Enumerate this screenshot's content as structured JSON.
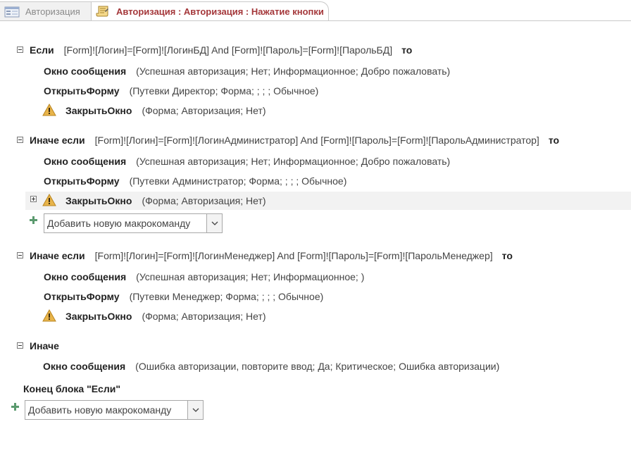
{
  "tabs": [
    {
      "label": "Авторизация",
      "icon": "form-icon",
      "active": false
    },
    {
      "label": "Авторизация : Авторизация : Нажатие кнопки",
      "icon": "macro-icon",
      "active": true
    }
  ],
  "blocks": {
    "if1": {
      "keyword": "Если",
      "condition": "[Form]![Логин]=[Form]![ЛогинБД] And [Form]![Пароль]=[Form]![ПарольБД]",
      "then": "то",
      "actions": [
        {
          "name": "Окно сообщения",
          "args": "(Успешная авторизация; Нет; Информационное; Добро пожаловать)"
        },
        {
          "name": "ОткрытьФорму",
          "args": "(Путевки Директор; Форма; ; ; ; Обычное)"
        },
        {
          "name": "ЗакрытьОкно",
          "args": "(Форма; Авторизация; Нет)",
          "warning": true
        }
      ]
    },
    "elseif1": {
      "keyword": "Иначе если",
      "condition": "[Form]![Логин]=[Form]![ЛогинАдминистратор] And [Form]![Пароль]=[Form]![ПарольАдминистратор]",
      "then": "то",
      "actions": [
        {
          "name": "Окно сообщения",
          "args": "(Успешная авторизация; Нет; Информационное; Добро пожаловать)"
        },
        {
          "name": "ОткрытьФорму",
          "args": "(Путевки Администратор; Форма; ; ; ; Обычное)"
        },
        {
          "name": "ЗакрытьОкно",
          "args": "(Форма; Авторизация; Нет)",
          "warning": true
        }
      ],
      "add_action": "Добавить новую макрокоманду"
    },
    "elseif2": {
      "keyword": "Иначе если",
      "condition": "[Form]![Логин]=[Form]![ЛогинМенеджер] And [Form]![Пароль]=[Form]![ПарольМенеджер]",
      "then": "то",
      "actions": [
        {
          "name": "Окно сообщения",
          "args": "(Успешная авторизация; Нет; Информационное; )"
        },
        {
          "name": "ОткрытьФорму",
          "args": "(Путевки Менеджер; Форма; ; ; ; Обычное)"
        },
        {
          "name": "ЗакрытьОкно",
          "args": "(Форма; Авторизация; Нет)",
          "warning": true
        }
      ]
    },
    "else": {
      "keyword": "Иначе",
      "actions": [
        {
          "name": "Окно сообщения",
          "args": "(Ошибка авторизации, повторите ввод; Да; Критическое; Ошибка авторизации)"
        }
      ]
    },
    "end_if": "Конец блока \"Если\"",
    "add_action_bottom": "Добавить новую макрокоманду"
  },
  "colors": {
    "active_tab_text": "#a4373a",
    "warning": "#e8b44a",
    "add_plus": "#5a9a6e"
  }
}
